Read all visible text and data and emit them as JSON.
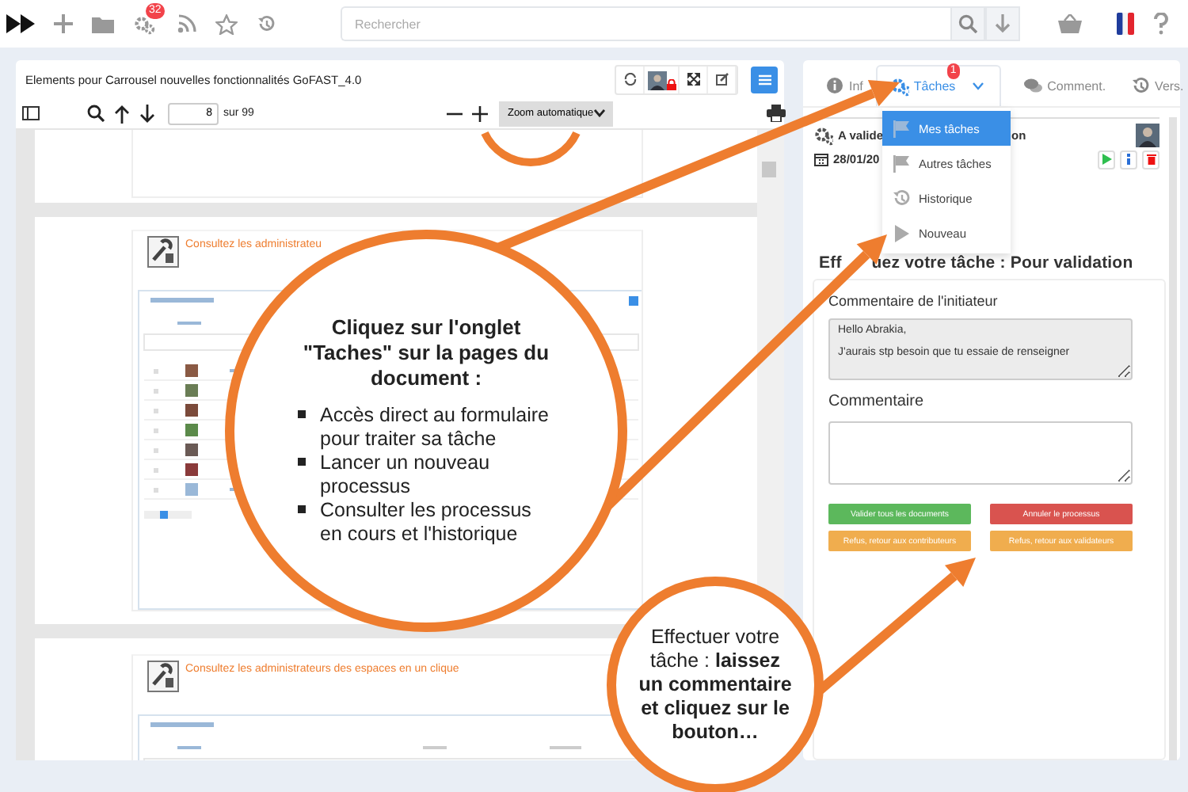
{
  "topbar": {
    "notification_count": "32",
    "search": {
      "placeholder": "Rechercher"
    }
  },
  "viewer": {
    "title": "Elements pour Carrousel nouvelles fonctionnalités GoFAST_4.0",
    "page": "8",
    "page_count": "sur 99",
    "zoom": "Zoom automatique",
    "pages": [
      {
        "heading": "Consultez les administrateu"
      },
      {
        "heading": "Consultez les administrateurs des espaces en un clique"
      }
    ]
  },
  "panel": {
    "tabs": [
      {
        "label": "Inf",
        "selected": false
      },
      {
        "label": "Tâches",
        "selected": true,
        "badge": "1"
      },
      {
        "label": "Comment.",
        "selected": false
      },
      {
        "label": "Vers.",
        "selected": false
      }
    ],
    "task": {
      "title": "A valide",
      "title_end": "on",
      "date": "28/01/20"
    },
    "menu": [
      {
        "label": "Mes tâches",
        "selected": true
      },
      {
        "label": "Autres tâches",
        "selected": false
      },
      {
        "label": "Historique",
        "selected": false
      },
      {
        "label": "Nouveau",
        "selected": false
      }
    ],
    "form": {
      "heading": "Eff",
      "heading_rest": "uez votre tâche : Pour validation",
      "initiator_label": "Commentaire de l'initiateur",
      "initiator_comment": "Hello Abrakia,\n\nJ'aurais stp besoin que tu essaie de renseigner",
      "comment_label": "Commentaire",
      "buttons": [
        {
          "label": "Valider tous les documents",
          "kind": "success"
        },
        {
          "label": "Annuler le processus",
          "kind": "danger"
        },
        {
          "label": "Refus, retour aux contributeurs",
          "kind": "warning"
        },
        {
          "label": "Refus, retour aux validateurs",
          "kind": "warning"
        }
      ]
    }
  },
  "callouts": [
    {
      "title": "Cliquez sur l'onglet \"Taches\" sur la pages du document :",
      "bullets": [
        "Accès direct au formulaire pour traiter sa tâche",
        "Lancer un nouveau processus",
        "Consulter les processus en cours et l'historique"
      ]
    },
    {
      "text": "Effectuer votre tâche : **laissez un commentaire et cliquez sur le bouton…**"
    }
  ]
}
